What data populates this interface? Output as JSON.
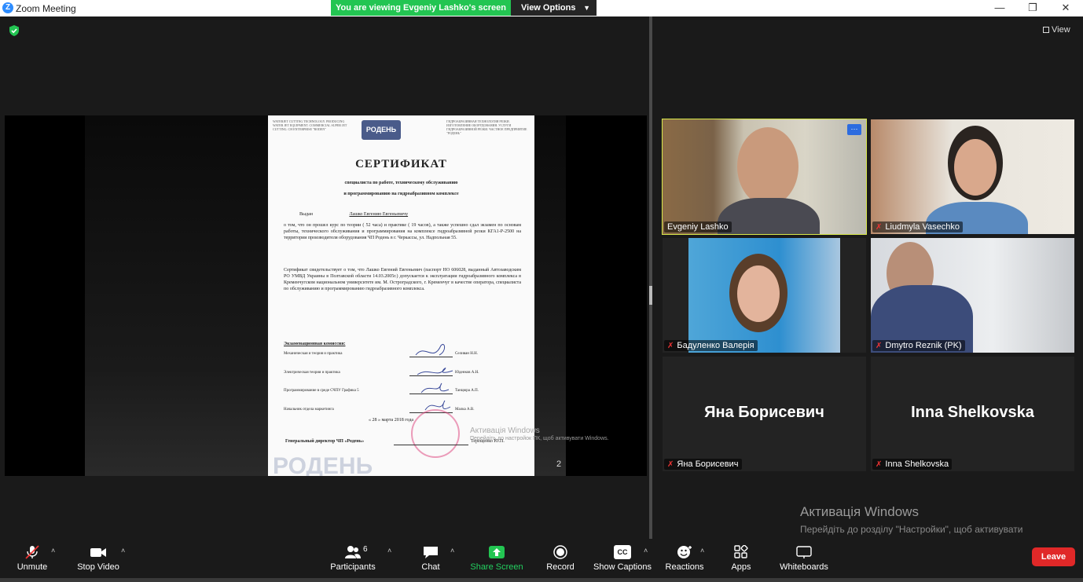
{
  "window": {
    "app_title": "Zoom Meeting",
    "logo_letter": "Z",
    "minimize": "—",
    "restore": "❐",
    "close": "✕"
  },
  "banner": {
    "viewing_text": "You are viewing Evgeniy Lashko's screen",
    "view_options_label": "View Options"
  },
  "shared_screen": {
    "page_number": "2",
    "activation_small_title": "Активація Windows",
    "activation_small_body": "Перейдіть до настройок ПК, щоб активувати Windows.",
    "document": {
      "logo_text": "РОДЕНЬ",
      "header_left": "WATERJET CUTTING TECHNOLOGY. PRODUCING WATER JET EQUIPMENT. COMMERCIAL SUPER JET CUTTING. CH ENTERPRISE \"RODEN\"",
      "header_right": "ГИДРОАБРАЗИВНАЯ ТЕХНОЛОГИЯ РЕЗКИ. ИЗГОТОВЛЕНИЕ ОБОРУДОВАНИЯ. УСЛУГИ ГИДРОАБРАЗИВНОЙ РЕЗКИ. ЧАСТНОЕ ПРЕДПРИЯТИЕ \"РОДЕНЬ\"",
      "title": "СЕРТИФИКАТ",
      "subtitle_1": "специалиста по работе, техническому обслуживанию",
      "subtitle_2": "и программированию на гидроабразивном комплексе",
      "issued_to_label": "Выдан",
      "issued_to_name": "Лашко Евгению Евгеньевичу",
      "para_1": "о том, что он прошел курс по теории ( 52 часа) и практике ( 19 часов), а также успешно сдал экзамен по основам работы, технического обслуживания и программирования на комплексе гидроабразивной резки КГА1-Р-2500 на территории производителя оборудования ЧП Родень в г. Черкассы, ул. Надпольная 55.",
      "para_2": "Сертификат свидетельствует о том, что Лашко Евгений Евгеньевич (паспорт НО 606028, выданный Автозаводским РО УМВД Украины в Полтавской области 14.03.2005г.) допускается к эксплуатации гидроабразивного комплекса в Кременчугском национальном университете им. М. Остроградского, г. Кременчуг в качестве оператора, специалиста по обслуживанию и программированию гидроабразивного комплекса.",
      "commission_label": "Экзаменационная комиссия:",
      "examiners": [
        {
          "subject": "Механическая и теория и практика",
          "name": "Селиван Н.Н."
        },
        {
          "subject": "Электрическая теория и практика",
          "name": "Юденков А.Н."
        },
        {
          "subject": "Программирование в среде СЧПУ Графика 5",
          "name": "Танцюра А.П."
        },
        {
          "subject": "Начальник отдела маркетинга",
          "name": "Малка А.В."
        }
      ],
      "date_text": "« 28 » марта 2018 года",
      "director_label": "Генеральный директор ЧП «Родень»",
      "director_name": "Терещенко Ю.П.",
      "footer_watermark": "РОДЕНЬ"
    }
  },
  "gallery": {
    "view_label": "View",
    "participants": [
      {
        "name": "Evgeniy Lashko",
        "muted": false,
        "active": true
      },
      {
        "name": "Liudmyla Vasechko",
        "muted": true,
        "active": false
      },
      {
        "name": "Бадуленко Валерія",
        "muted": true,
        "active": false
      },
      {
        "name": "Dmytro Reznik (PK)",
        "muted": true,
        "active": false
      },
      {
        "name": "Яна Борисевич",
        "muted": true,
        "active": false,
        "display_big": "Яна Борисевич"
      },
      {
        "name": "Inna Shelkovska",
        "muted": true,
        "active": false,
        "display_big": "Inna Shelkovska"
      }
    ],
    "more_icon": "···"
  },
  "activation": {
    "title": "Активація Windows",
    "body": "Перейдіть до розділу \"Настройки\", щоб активувати Windows."
  },
  "toolbar": {
    "unmute": "Unmute",
    "stop_video": "Stop Video",
    "participants": "Participants",
    "participants_count": "6",
    "chat": "Chat",
    "share_screen": "Share Screen",
    "record": "Record",
    "show_captions": "Show Captions",
    "cc_text": "CC",
    "reactions": "Reactions",
    "apps": "Apps",
    "whiteboards": "Whiteboards",
    "leave": "Leave",
    "caret": "˄"
  },
  "colors": {
    "accent_green": "#23c552",
    "leave_red": "#e02828",
    "active_speaker": "#d8e84a",
    "mute_red": "#e33333"
  }
}
